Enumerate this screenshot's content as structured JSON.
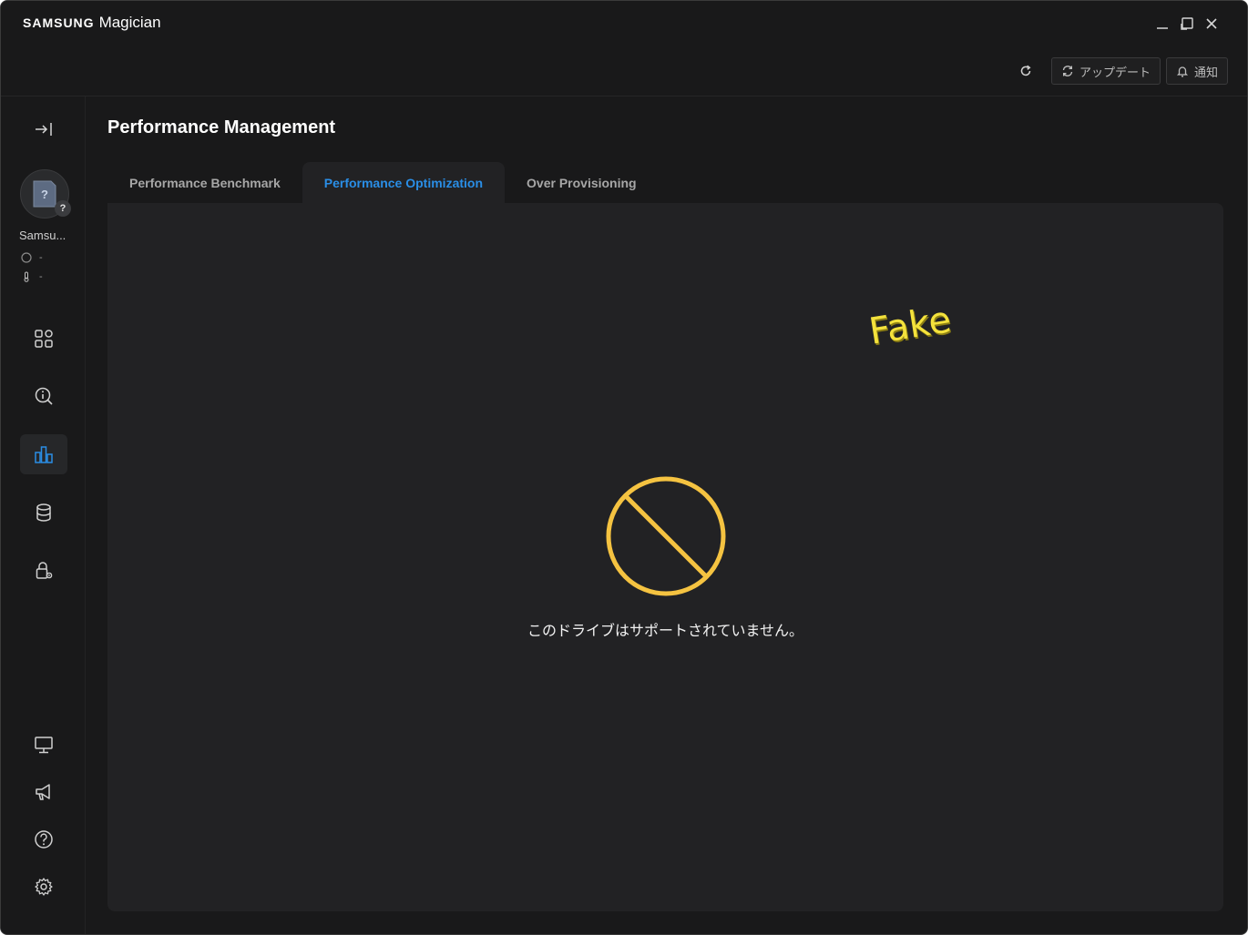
{
  "app": {
    "brand_samsung": "SAMSUNG",
    "brand_product": "Magician"
  },
  "header": {
    "update_label": "アップデート",
    "notify_label": "通知"
  },
  "sidebar": {
    "drive_name": "Samsu...",
    "drive_badge": "?",
    "status_value": "-",
    "temperature_value": "-",
    "active_item": "performance-management"
  },
  "main": {
    "title": "Performance Management",
    "tabs": [
      {
        "label": "Performance Benchmark",
        "active": false
      },
      {
        "label": "Performance Optimization",
        "active": true
      },
      {
        "label": "Over Provisioning",
        "active": false
      }
    ],
    "stamp_text": "Fake",
    "message": "このドライブはサポートされていません。"
  },
  "colors": {
    "accent": "#2a8ee6",
    "warning": "#f5c341",
    "stamp": "#f4e23c",
    "background": "#19191a",
    "panel": "#222224"
  }
}
